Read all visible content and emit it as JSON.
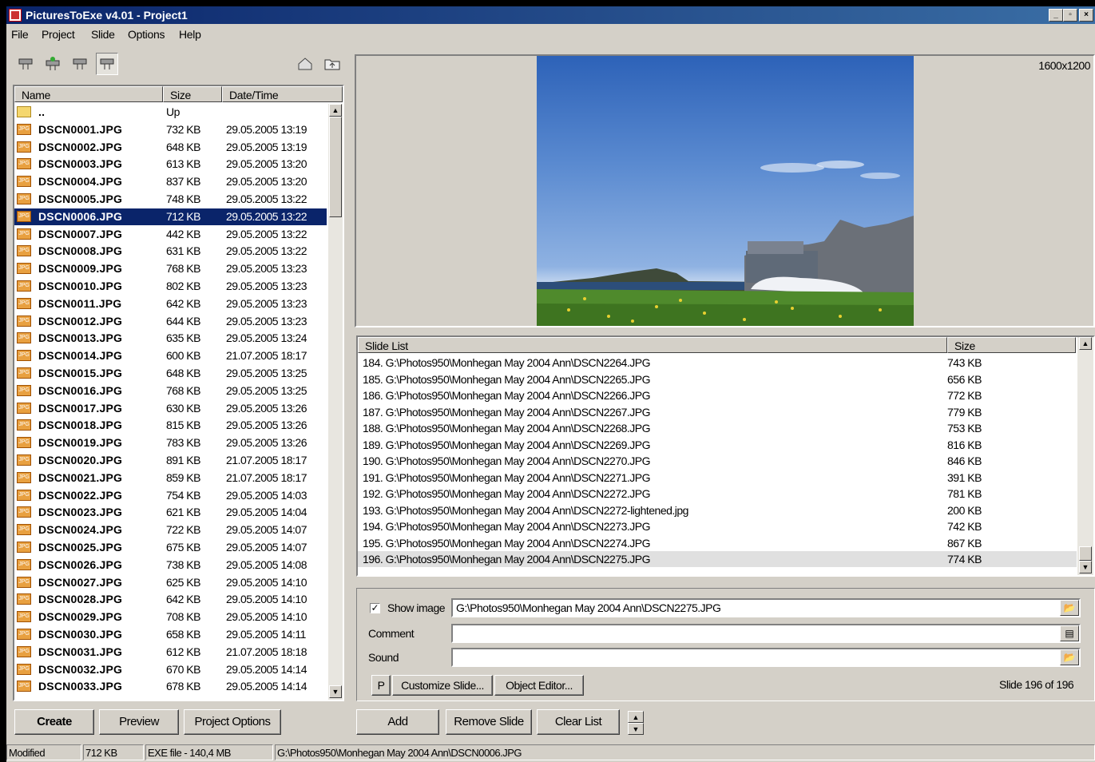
{
  "window": {
    "title": "PicturesToExe v4.01 - Project1",
    "controls": [
      "_",
      "▫",
      "×"
    ]
  },
  "menu": [
    "File",
    "Project",
    "Slide",
    "Options",
    "Help"
  ],
  "filelist": {
    "headers": {
      "name": "Name",
      "size": "Size",
      "date": "Date/Time"
    },
    "up": {
      "name": "..",
      "size": "Up"
    },
    "rows": [
      {
        "name": "DSCN0001.JPG",
        "size": "732 KB",
        "date": "29.05.2005  13:19"
      },
      {
        "name": "DSCN0002.JPG",
        "size": "648 KB",
        "date": "29.05.2005  13:19"
      },
      {
        "name": "DSCN0003.JPG",
        "size": "613 KB",
        "date": "29.05.2005  13:20"
      },
      {
        "name": "DSCN0004.JPG",
        "size": "837 KB",
        "date": "29.05.2005  13:20"
      },
      {
        "name": "DSCN0005.JPG",
        "size": "748 KB",
        "date": "29.05.2005  13:22"
      },
      {
        "name": "DSCN0006.JPG",
        "size": "712 KB",
        "date": "29.05.2005  13:22"
      },
      {
        "name": "DSCN0007.JPG",
        "size": "442 KB",
        "date": "29.05.2005  13:22"
      },
      {
        "name": "DSCN0008.JPG",
        "size": "631 KB",
        "date": "29.05.2005  13:22"
      },
      {
        "name": "DSCN0009.JPG",
        "size": "768 KB",
        "date": "29.05.2005  13:23"
      },
      {
        "name": "DSCN0010.JPG",
        "size": "802 KB",
        "date": "29.05.2005  13:23"
      },
      {
        "name": "DSCN0011.JPG",
        "size": "642 KB",
        "date": "29.05.2005  13:23"
      },
      {
        "name": "DSCN0012.JPG",
        "size": "644 KB",
        "date": "29.05.2005  13:23"
      },
      {
        "name": "DSCN0013.JPG",
        "size": "635 KB",
        "date": "29.05.2005  13:24"
      },
      {
        "name": "DSCN0014.JPG",
        "size": "600 KB",
        "date": "21.07.2005  18:17"
      },
      {
        "name": "DSCN0015.JPG",
        "size": "648 KB",
        "date": "29.05.2005  13:25"
      },
      {
        "name": "DSCN0016.JPG",
        "size": "768 KB",
        "date": "29.05.2005  13:25"
      },
      {
        "name": "DSCN0017.JPG",
        "size": "630 KB",
        "date": "29.05.2005  13:26"
      },
      {
        "name": "DSCN0018.JPG",
        "size": "815 KB",
        "date": "29.05.2005  13:26"
      },
      {
        "name": "DSCN0019.JPG",
        "size": "783 KB",
        "date": "29.05.2005  13:26"
      },
      {
        "name": "DSCN0020.JPG",
        "size": "891 KB",
        "date": "21.07.2005  18:17"
      },
      {
        "name": "DSCN0021.JPG",
        "size": "859 KB",
        "date": "21.07.2005  18:17"
      },
      {
        "name": "DSCN0022.JPG",
        "size": "754 KB",
        "date": "29.05.2005  14:03"
      },
      {
        "name": "DSCN0023.JPG",
        "size": "621 KB",
        "date": "29.05.2005  14:04"
      },
      {
        "name": "DSCN0024.JPG",
        "size": "722 KB",
        "date": "29.05.2005  14:07"
      },
      {
        "name": "DSCN0025.JPG",
        "size": "675 KB",
        "date": "29.05.2005  14:07"
      },
      {
        "name": "DSCN0026.JPG",
        "size": "738 KB",
        "date": "29.05.2005  14:08"
      },
      {
        "name": "DSCN0027.JPG",
        "size": "625 KB",
        "date": "29.05.2005  14:10"
      },
      {
        "name": "DSCN0028.JPG",
        "size": "642 KB",
        "date": "29.05.2005  14:10"
      },
      {
        "name": "DSCN0029.JPG",
        "size": "708 KB",
        "date": "29.05.2005  14:10"
      },
      {
        "name": "DSCN0030.JPG",
        "size": "658 KB",
        "date": "29.05.2005  14:11"
      },
      {
        "name": "DSCN0031.JPG",
        "size": "612 KB",
        "date": "21.07.2005  18:18"
      },
      {
        "name": "DSCN0032.JPG",
        "size": "670 KB",
        "date": "29.05.2005  14:14"
      },
      {
        "name": "DSCN0033.JPG",
        "size": "678 KB",
        "date": "29.05.2005  14:14"
      }
    ],
    "selected_index": 5
  },
  "preview": {
    "resolution": "1600x1200"
  },
  "slidelist": {
    "headers": {
      "name": "Slide List",
      "size": "Size"
    },
    "rows": [
      {
        "path": "184. G:\\Photos950\\Monhegan May 2004 Ann\\DSCN2264.JPG",
        "size": "743 KB"
      },
      {
        "path": "185. G:\\Photos950\\Monhegan May 2004 Ann\\DSCN2265.JPG",
        "size": "656 KB"
      },
      {
        "path": "186. G:\\Photos950\\Monhegan May 2004 Ann\\DSCN2266.JPG",
        "size": "772 KB"
      },
      {
        "path": "187. G:\\Photos950\\Monhegan May 2004 Ann\\DSCN2267.JPG",
        "size": "779 KB"
      },
      {
        "path": "188. G:\\Photos950\\Monhegan May 2004 Ann\\DSCN2268.JPG",
        "size": "753 KB"
      },
      {
        "path": "189. G:\\Photos950\\Monhegan May 2004 Ann\\DSCN2269.JPG",
        "size": "816 KB"
      },
      {
        "path": "190. G:\\Photos950\\Monhegan May 2004 Ann\\DSCN2270.JPG",
        "size": "846 KB"
      },
      {
        "path": "191. G:\\Photos950\\Monhegan May 2004 Ann\\DSCN2271.JPG",
        "size": "391 KB"
      },
      {
        "path": "192. G:\\Photos950\\Monhegan May 2004 Ann\\DSCN2272.JPG",
        "size": "781 KB"
      },
      {
        "path": "193. G:\\Photos950\\Monhegan May 2004 Ann\\DSCN2272-lightened.jpg",
        "size": "200 KB"
      },
      {
        "path": "194. G:\\Photos950\\Monhegan May 2004 Ann\\DSCN2273.JPG",
        "size": "742 KB"
      },
      {
        "path": "195. G:\\Photos950\\Monhegan May 2004 Ann\\DSCN2274.JPG",
        "size": "867 KB"
      },
      {
        "path": "196. G:\\Photos950\\Monhegan May 2004 Ann\\DSCN2275.JPG",
        "size": "774 KB"
      }
    ],
    "selected_index": 12
  },
  "props": {
    "show_image_label": "Show image",
    "show_image_checked": "✓",
    "image_path": "G:\\Photos950\\Monhegan May 2004 Ann\\DSCN2275.JPG",
    "comment_label": "Comment",
    "comment_value": "",
    "sound_label": "Sound",
    "sound_value": "",
    "p_button": "P",
    "customize_button": "Customize Slide...",
    "object_editor_button": "Object Editor...",
    "slide_counter": "Slide 196 of 196"
  },
  "buttons": {
    "create": "Create",
    "preview": "Preview",
    "project_options": "Project Options",
    "add": "Add",
    "remove_slide": "Remove Slide",
    "clear_list": "Clear List"
  },
  "status": {
    "state": "Modified",
    "size": "712 KB",
    "exe": "EXE file - 140,4 MB",
    "path": "G:\\Photos950\\Monhegan May 2004 Ann\\DSCN0006.JPG"
  }
}
